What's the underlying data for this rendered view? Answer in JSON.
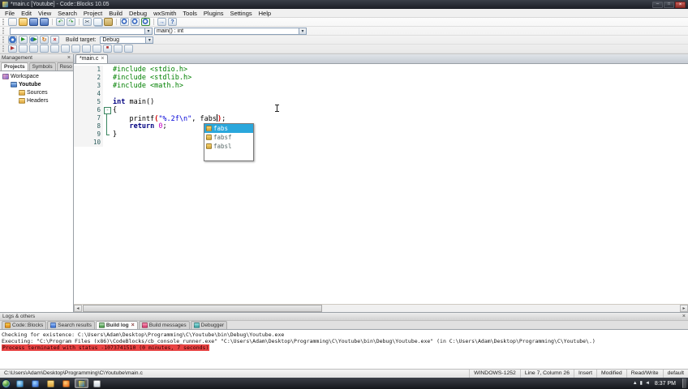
{
  "palette": {
    "accent_selection": "#2aa7dc",
    "error_highlight": "#e84343",
    "code_preprocessor": "#008000",
    "code_keyword": "#000080",
    "code_string": "#0000d8",
    "code_number": "#c000c0",
    "code_brace_match": "#d40000",
    "line_number": "#2f5f5f",
    "fold_line": "#39855f"
  },
  "window": {
    "title": "*main.c [Youtube] - Code::Blocks 10.05"
  },
  "menu": {
    "items": [
      "File",
      "Edit",
      "View",
      "Search",
      "Project",
      "Build",
      "Debug",
      "wxSmith",
      "Tools",
      "Plugins",
      "Settings",
      "Help"
    ]
  },
  "toolbars": {
    "row1_icons": [
      "new-file",
      "open-file",
      "save",
      "save-all",
      "sep",
      "undo",
      "redo",
      "sep",
      "cut",
      "copy",
      "paste",
      "sep",
      "find",
      "find-in-files",
      "replace",
      "sep",
      "goto-line",
      "help"
    ],
    "symbol_combo_value": "main() : int",
    "row3_icons": [
      "build",
      "run",
      "build-and-run",
      "rebuild",
      "abort"
    ],
    "build_target_label": "Build target:",
    "build_target_value": "Debug",
    "row4_icons": [
      "debug-continue",
      "run-to-cursor",
      "next-line",
      "step-into",
      "step-out",
      "next-instruction",
      "toggle-breakpoint",
      "debug-window",
      "debug-info",
      "stop-debugger",
      "wxsmith-tool",
      "wxsmith-preview"
    ]
  },
  "management": {
    "title": "Management",
    "close_glyph": "×",
    "tabs": [
      {
        "label": "Projects",
        "active": true
      },
      {
        "label": "Symbols",
        "active": false
      },
      {
        "label": "Reso",
        "active": false
      }
    ],
    "tree": [
      {
        "label": "Workspace",
        "depth": 0,
        "icon": "workspace-icon",
        "bold": false
      },
      {
        "label": "Youtube",
        "depth": 1,
        "icon": "project-icon",
        "bold": true
      },
      {
        "label": "Sources",
        "depth": 2,
        "icon": "folder-icon",
        "bold": false
      },
      {
        "label": "Headers",
        "depth": 2,
        "icon": "folder-icon",
        "bold": false
      }
    ]
  },
  "editor": {
    "tab_label": "*main.c",
    "tab_close": "×",
    "lines": [
      {
        "n": "1",
        "f": "",
        "s": [
          {
            "c": "pp",
            "t": "#include <stdio.h>"
          }
        ]
      },
      {
        "n": "2",
        "f": "",
        "s": [
          {
            "c": "pp",
            "t": "#include <stdlib.h>"
          }
        ]
      },
      {
        "n": "3",
        "f": "",
        "s": [
          {
            "c": "pp",
            "t": "#include <math.h>"
          }
        ]
      },
      {
        "n": "4",
        "f": "",
        "s": []
      },
      {
        "n": "5",
        "f": "",
        "s": [
          {
            "c": "kw",
            "t": "int"
          },
          {
            "c": "pl",
            "t": " main()"
          }
        ]
      },
      {
        "n": "6",
        "f": "start",
        "s": [
          {
            "c": "pl",
            "t": "{"
          }
        ]
      },
      {
        "n": "7",
        "f": "mid",
        "s": [
          {
            "c": "pl",
            "t": "    printf"
          },
          {
            "c": "br",
            "t": "("
          },
          {
            "c": "st",
            "t": "\"%.2f\\n\""
          },
          {
            "c": "pl",
            "t": ", fabs"
          },
          {
            "c": "caret",
            "t": ""
          },
          {
            "c": "br",
            "t": ")"
          },
          {
            "c": "pl",
            "t": ";"
          }
        ]
      },
      {
        "n": "8",
        "f": "mid",
        "s": [
          {
            "c": "pl",
            "t": "    "
          },
          {
            "c": "kw",
            "t": "return"
          },
          {
            "c": "pl",
            "t": " "
          },
          {
            "c": "nu",
            "t": "0"
          },
          {
            "c": "pl",
            "t": ";"
          }
        ]
      },
      {
        "n": "9",
        "f": "end",
        "s": [
          {
            "c": "pl",
            "t": "}"
          }
        ]
      },
      {
        "n": "10",
        "f": "",
        "s": []
      }
    ]
  },
  "autocomplete": {
    "items": [
      {
        "label": "fabs",
        "selected": true
      },
      {
        "label": "fabsf",
        "selected": false
      },
      {
        "label": "fabsl",
        "selected": false
      }
    ]
  },
  "logs": {
    "title": "Logs & others",
    "close_glyph": "×",
    "tabs": [
      {
        "label": "Code::Blocks",
        "active": false,
        "closable": false
      },
      {
        "label": "Search results",
        "active": false,
        "closable": false
      },
      {
        "label": "Build log",
        "active": true,
        "closable": true
      },
      {
        "label": "Build messages",
        "active": false,
        "closable": false
      },
      {
        "label": "Debugger",
        "active": false,
        "closable": false
      }
    ],
    "lines": [
      {
        "cls": "log-normal",
        "text": "Checking for existence: C:\\Users\\Adam\\Desktop\\Programming\\C\\Youtube\\bin\\Debug\\Youtube.exe"
      },
      {
        "cls": "log-normal",
        "text": "Executing: \"C:\\Program Files (x86)\\CodeBlocks/cb_console_runner.exe\" \"C:\\Users\\Adam\\Desktop\\Programming\\C\\Youtube\\bin\\Debug\\Youtube.exe\"  (in C:\\Users\\Adam\\Desktop\\Programming\\C\\Youtube\\.)"
      },
      {
        "cls": "log-error",
        "text": "Process terminated with status -1073741510 (0 minutes, 7 seconds)"
      }
    ]
  },
  "statusbar": {
    "path": "C:\\Users\\Adam\\Desktop\\Programming\\C\\Youtube\\main.c",
    "encoding": "WINDOWS-1252",
    "position": "Line 7, Column 26",
    "overwrite": "Insert",
    "modified": "Modified",
    "readwrite": "Read/Write",
    "profile": "default"
  },
  "taskbar": {
    "apps": [
      {
        "name": "windows-media-player",
        "active": false
      },
      {
        "name": "internet-explorer",
        "active": false
      },
      {
        "name": "file-explorer",
        "active": false
      },
      {
        "name": "firefox",
        "active": false
      },
      {
        "name": "codeblocks",
        "active": true
      },
      {
        "name": "notepad",
        "active": false
      }
    ],
    "tray_icons": [
      {
        "name": "hidden-icons-icon",
        "glyph": "▲"
      },
      {
        "name": "network-icon",
        "glyph": "▮"
      },
      {
        "name": "volume-icon",
        "glyph": "◄"
      }
    ],
    "tray_time": "8:37 PM"
  }
}
